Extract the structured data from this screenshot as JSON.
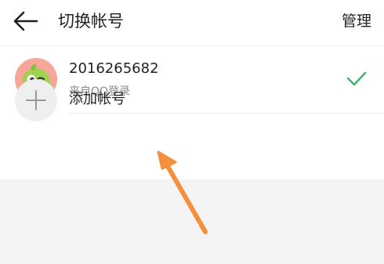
{
  "header": {
    "back_icon": "arrow-left-icon",
    "title": "切换帐号",
    "manage_label": "管理"
  },
  "accounts": [
    {
      "id": "2016265682",
      "source": "来自QQ登录",
      "avatar": "green-bird-cartoon-avatar",
      "selected": true,
      "check_icon": "checkmark-icon",
      "check_color": "#3fb06a"
    }
  ],
  "add_account": {
    "icon": "plus-icon",
    "label": "添加帐号"
  },
  "annotation": {
    "icon": "arrow-pointer-icon",
    "color": "#f58f3c"
  },
  "colors": {
    "background": "#f4f4f4",
    "surface": "#ffffff",
    "divider": "#ededed",
    "text_primary": "#222222",
    "text_secondary": "#8a8a8a",
    "accent_check": "#3fb06a",
    "annotation_arrow": "#f58f3c"
  }
}
